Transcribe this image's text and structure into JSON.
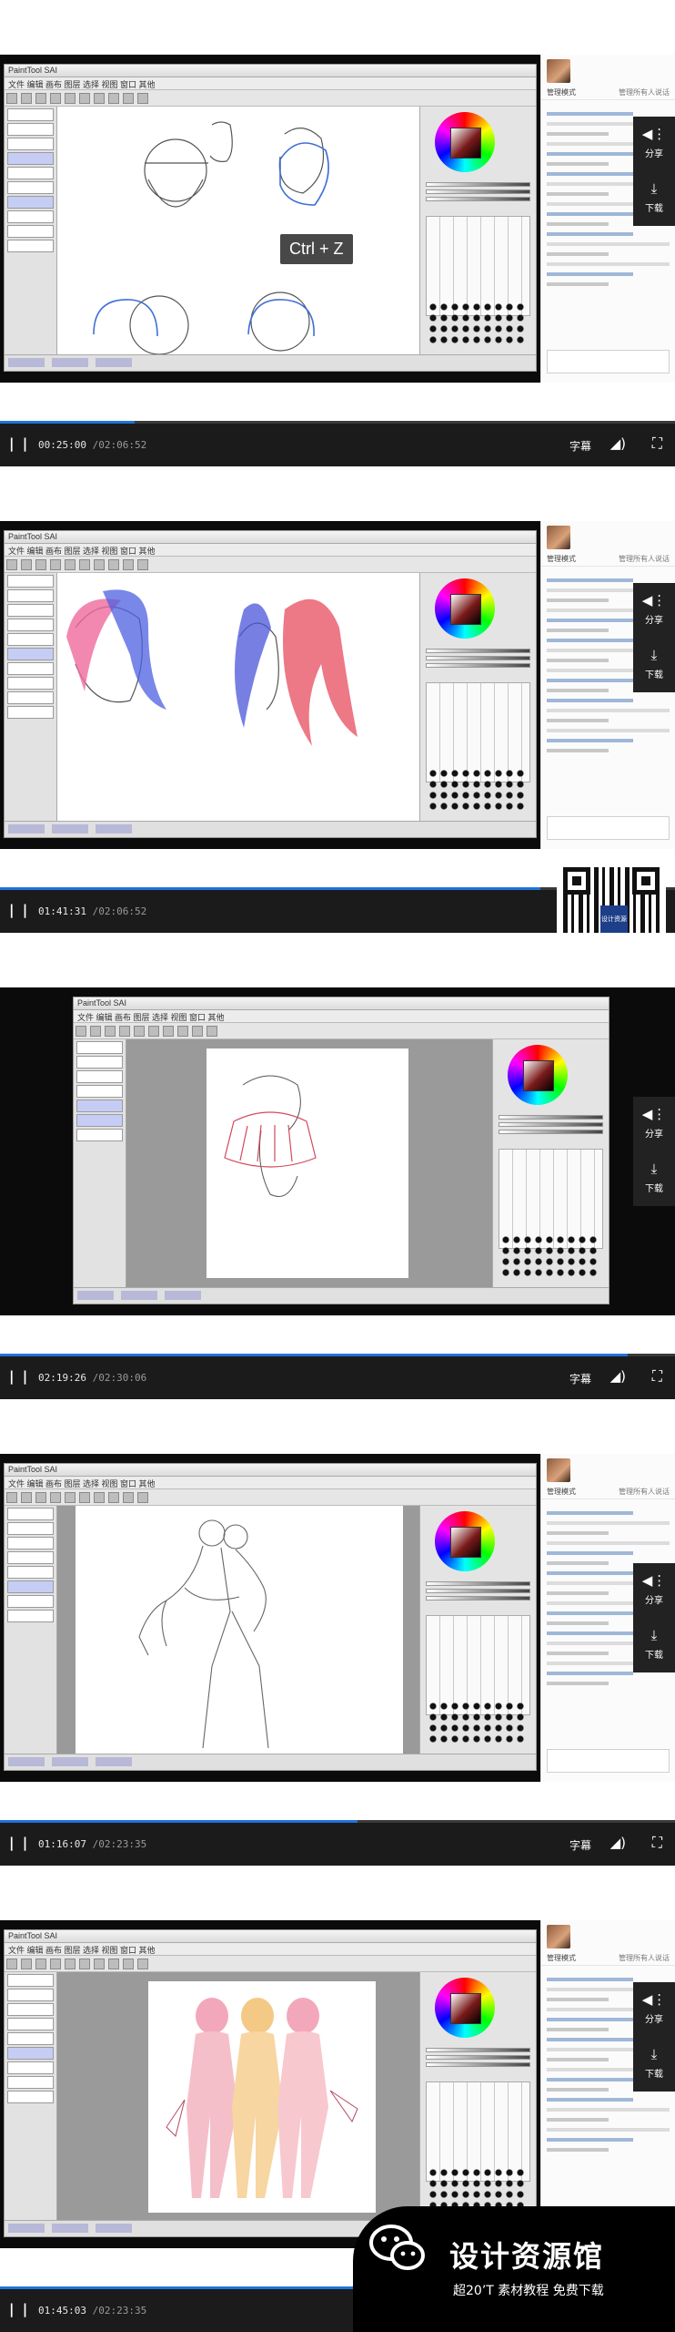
{
  "frames": [
    {
      "sai_title": "PaintTool SAI",
      "menu": "文件 编辑 画布 图层 选择 视图 窗口 其他",
      "overlay_text": "Ctrl + Z",
      "chat": {
        "mode": "管理模式",
        "manage": "管理所有人说话"
      },
      "actions": {
        "share": "分享",
        "download": "下载"
      },
      "controls": {
        "current": "00:25:00",
        "total": " /02:06:52",
        "subtitle": "字幕",
        "progress": 0.2
      }
    },
    {
      "sai_title": "PaintTool SAI",
      "menu": "文件 编辑 画布 图层 选择 视图 窗口 其他",
      "chat": {
        "mode": "管理模式",
        "manage": "管理所有人说话"
      },
      "actions": {
        "share": "分享",
        "download": "下载"
      },
      "controls": {
        "current": "01:41:31",
        "total": " /02:06:52",
        "progress": 0.8
      }
    },
    {
      "sai_title": "PaintTool SAI",
      "menu": "文件 编辑 画布 图层 选择 视图 窗口 其他",
      "actions": {
        "share": "分享",
        "download": "下载"
      },
      "controls": {
        "current": "02:19:26",
        "total": " /02:30:06",
        "subtitle": "字幕",
        "progress": 0.93
      }
    },
    {
      "sai_title": "PaintTool SAI",
      "menu": "文件 编辑 画布 图层 选择 视图 窗口 其他",
      "chat": {
        "mode": "管理模式",
        "manage": "管理所有人说话"
      },
      "actions": {
        "share": "分享",
        "download": "下载"
      },
      "controls": {
        "current": "01:16:07",
        "total": " /02:23:35",
        "subtitle": "字幕",
        "progress": 0.53
      }
    },
    {
      "sai_title": "PaintTool SAI",
      "menu": "文件 编辑 画布 图层 选择 视图 窗口 其他",
      "chat": {
        "mode": "管理模式",
        "manage": "管理所有人说话"
      },
      "actions": {
        "share": "分享",
        "download": "下载"
      },
      "controls": {
        "current": "01:45:03",
        "total": " /02:23:35",
        "progress": 0.73
      }
    }
  ],
  "qr_logo": "设计资源",
  "watermark": {
    "title": "设计资源馆",
    "tagline": "超20’T 素材教程 免费下载"
  },
  "icons": {
    "play": "pause-icon",
    "volume": "volume-icon",
    "fullscreen": "fullscreen-icon",
    "share": "share-icon",
    "download": "download-icon"
  },
  "colors": {
    "progress": "#1f73d8",
    "control_bar": "#1b1b1b",
    "sai_accent": "#c6cdf5"
  }
}
